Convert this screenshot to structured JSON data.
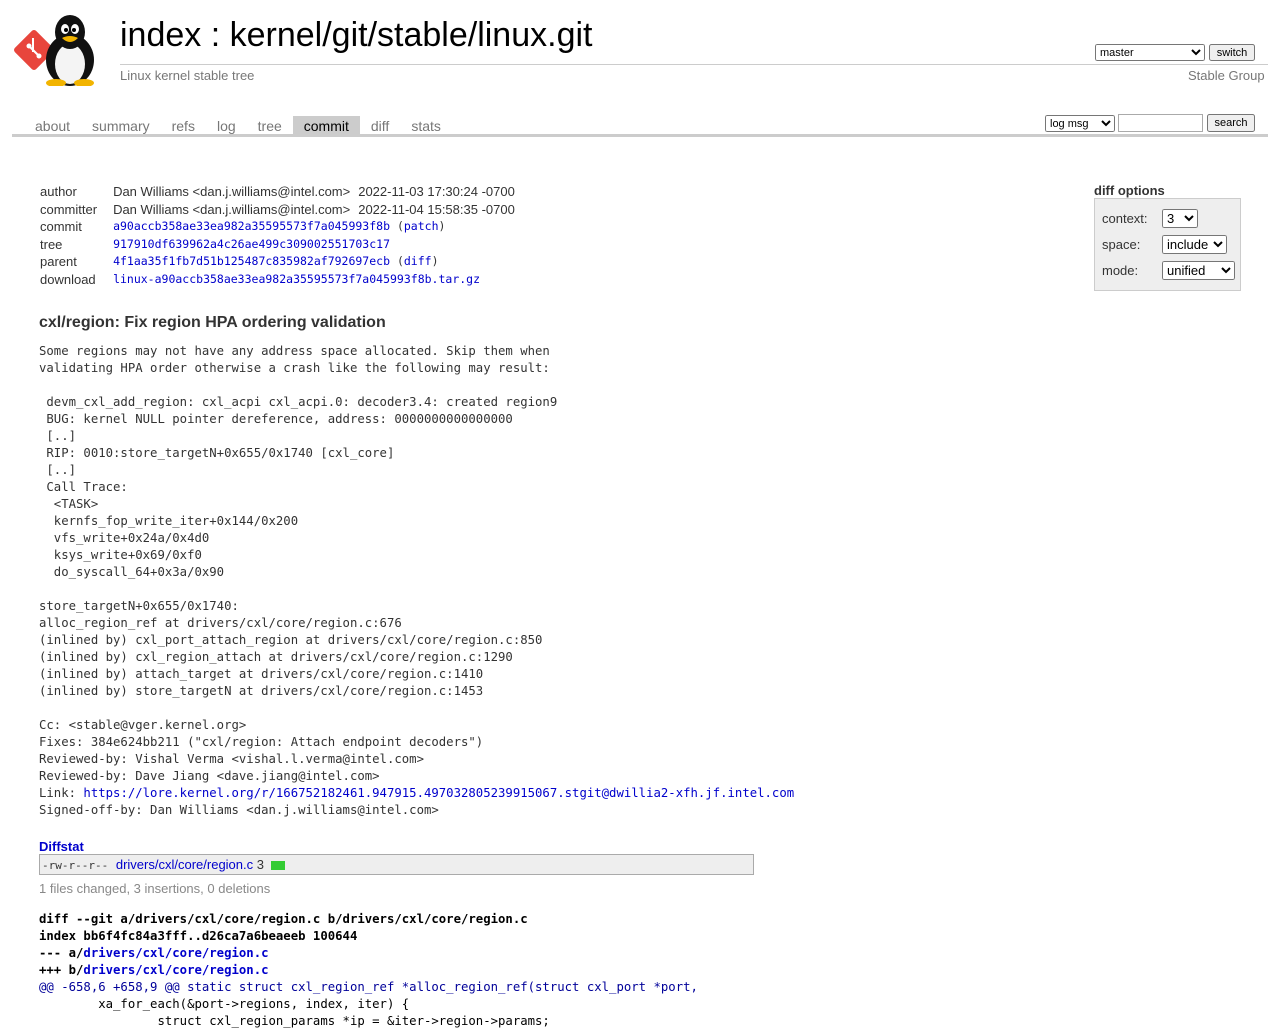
{
  "header": {
    "index_link": "index",
    "separator": " : ",
    "repo_path": "kernel/git/stable/linux.git",
    "subtitle": "Linux kernel stable tree",
    "owner": "Stable Group",
    "branch_selected": "master",
    "switch_label": "switch"
  },
  "tabs": [
    {
      "label": "about"
    },
    {
      "label": "summary"
    },
    {
      "label": "refs"
    },
    {
      "label": "log"
    },
    {
      "label": "tree"
    },
    {
      "label": "commit",
      "active": true
    },
    {
      "label": "diff"
    },
    {
      "label": "stats"
    }
  ],
  "search": {
    "type_selected": "log msg",
    "query": "",
    "button_label": "search"
  },
  "commit_info": {
    "author_label": "author",
    "author": "Dan Williams <dan.j.williams@intel.com>",
    "author_date": "2022-11-03 17:30:24 -0700",
    "committer_label": "committer",
    "committer": "Dan Williams <dan.j.williams@intel.com>",
    "committer_date": "2022-11-04 15:58:35 -0700",
    "commit_label": "commit",
    "commit": "a90accb358ae33ea982a35595573f7a045993f8b",
    "commit_extra": "patch",
    "tree_label": "tree",
    "tree": "917910df639962a4c26ae499c309002551703c17",
    "parent_label": "parent",
    "parent": "4f1aa35f1fb7d51b125487c835982af792697ecb",
    "parent_extra": "diff",
    "download_label": "download",
    "download": "linux-a90accb358ae33ea982a35595573f7a045993f8b.tar.gz"
  },
  "diff_options": {
    "title": "diff options",
    "context_label": "context:",
    "context_value": "3",
    "space_label": "space:",
    "space_value": "include",
    "mode_label": "mode:",
    "mode_value": "unified"
  },
  "message": {
    "subject": "cxl/region: Fix region HPA ordering validation",
    "body_before_link": "Some regions may not have any address space allocated. Skip them when\nvalidating HPA order otherwise a crash like the following may result:\n\n devm_cxl_add_region: cxl_acpi cxl_acpi.0: decoder3.4: created region9\n BUG: kernel NULL pointer dereference, address: 0000000000000000\n [..]\n RIP: 0010:store_targetN+0x655/0x1740 [cxl_core]\n [..]\n Call Trace:\n  <TASK>\n  kernfs_fop_write_iter+0x144/0x200\n  vfs_write+0x24a/0x4d0\n  ksys_write+0x69/0xf0\n  do_syscall_64+0x3a/0x90\n\nstore_targetN+0x655/0x1740:\nalloc_region_ref at drivers/cxl/core/region.c:676\n(inlined by) cxl_port_attach_region at drivers/cxl/core/region.c:850\n(inlined by) cxl_region_attach at drivers/cxl/core/region.c:1290\n(inlined by) attach_target at drivers/cxl/core/region.c:1410\n(inlined by) store_targetN at drivers/cxl/core/region.c:1453\n\nCc: <stable@vger.kernel.org>\nFixes: 384e624bb211 (\"cxl/region: Attach endpoint decoders\")\nReviewed-by: Vishal Verma <vishal.l.verma@intel.com>\nReviewed-by: Dave Jiang <dave.jiang@intel.com>\nLink: ",
    "link_url": "https://lore.kernel.org/r/166752182461.947915.497032805239915067.stgit@dwillia2-xfh.jf.intel.com",
    "body_after_link": "\nSigned-off-by: Dan Williams <dan.j.williams@intel.com>"
  },
  "diffstat": {
    "header": "Diffstat",
    "mode": "-rw-r--r--",
    "file": "drivers/cxl/core/region.c",
    "changes": "3",
    "summary": "1 files changed, 3 insertions, 0 deletions"
  },
  "diff": {
    "line1": "diff --git a/drivers/cxl/core/region.c b/drivers/cxl/core/region.c",
    "line2": "index bb6f4fc84a3fff..d26ca7a6beaeeb 100644",
    "line3_prefix": "--- a/",
    "line3_file": "drivers/cxl/core/region.c",
    "line4_prefix": "+++ b/",
    "line4_file": "drivers/cxl/core/region.c",
    "hunk": "@@ -658,6 +658,9 @@ static struct cxl_region_ref *alloc_region_ref(struct cxl_port *port,",
    "ctx1": "        xa_for_each(&port->regions, index, iter) {",
    "ctx2": "                struct cxl_region_params *ip = &iter->region->params;"
  },
  "colors": {
    "link": "#0000cc",
    "tab_active_bg": "#cccccc",
    "diffstat_bar": "#33cc33"
  }
}
